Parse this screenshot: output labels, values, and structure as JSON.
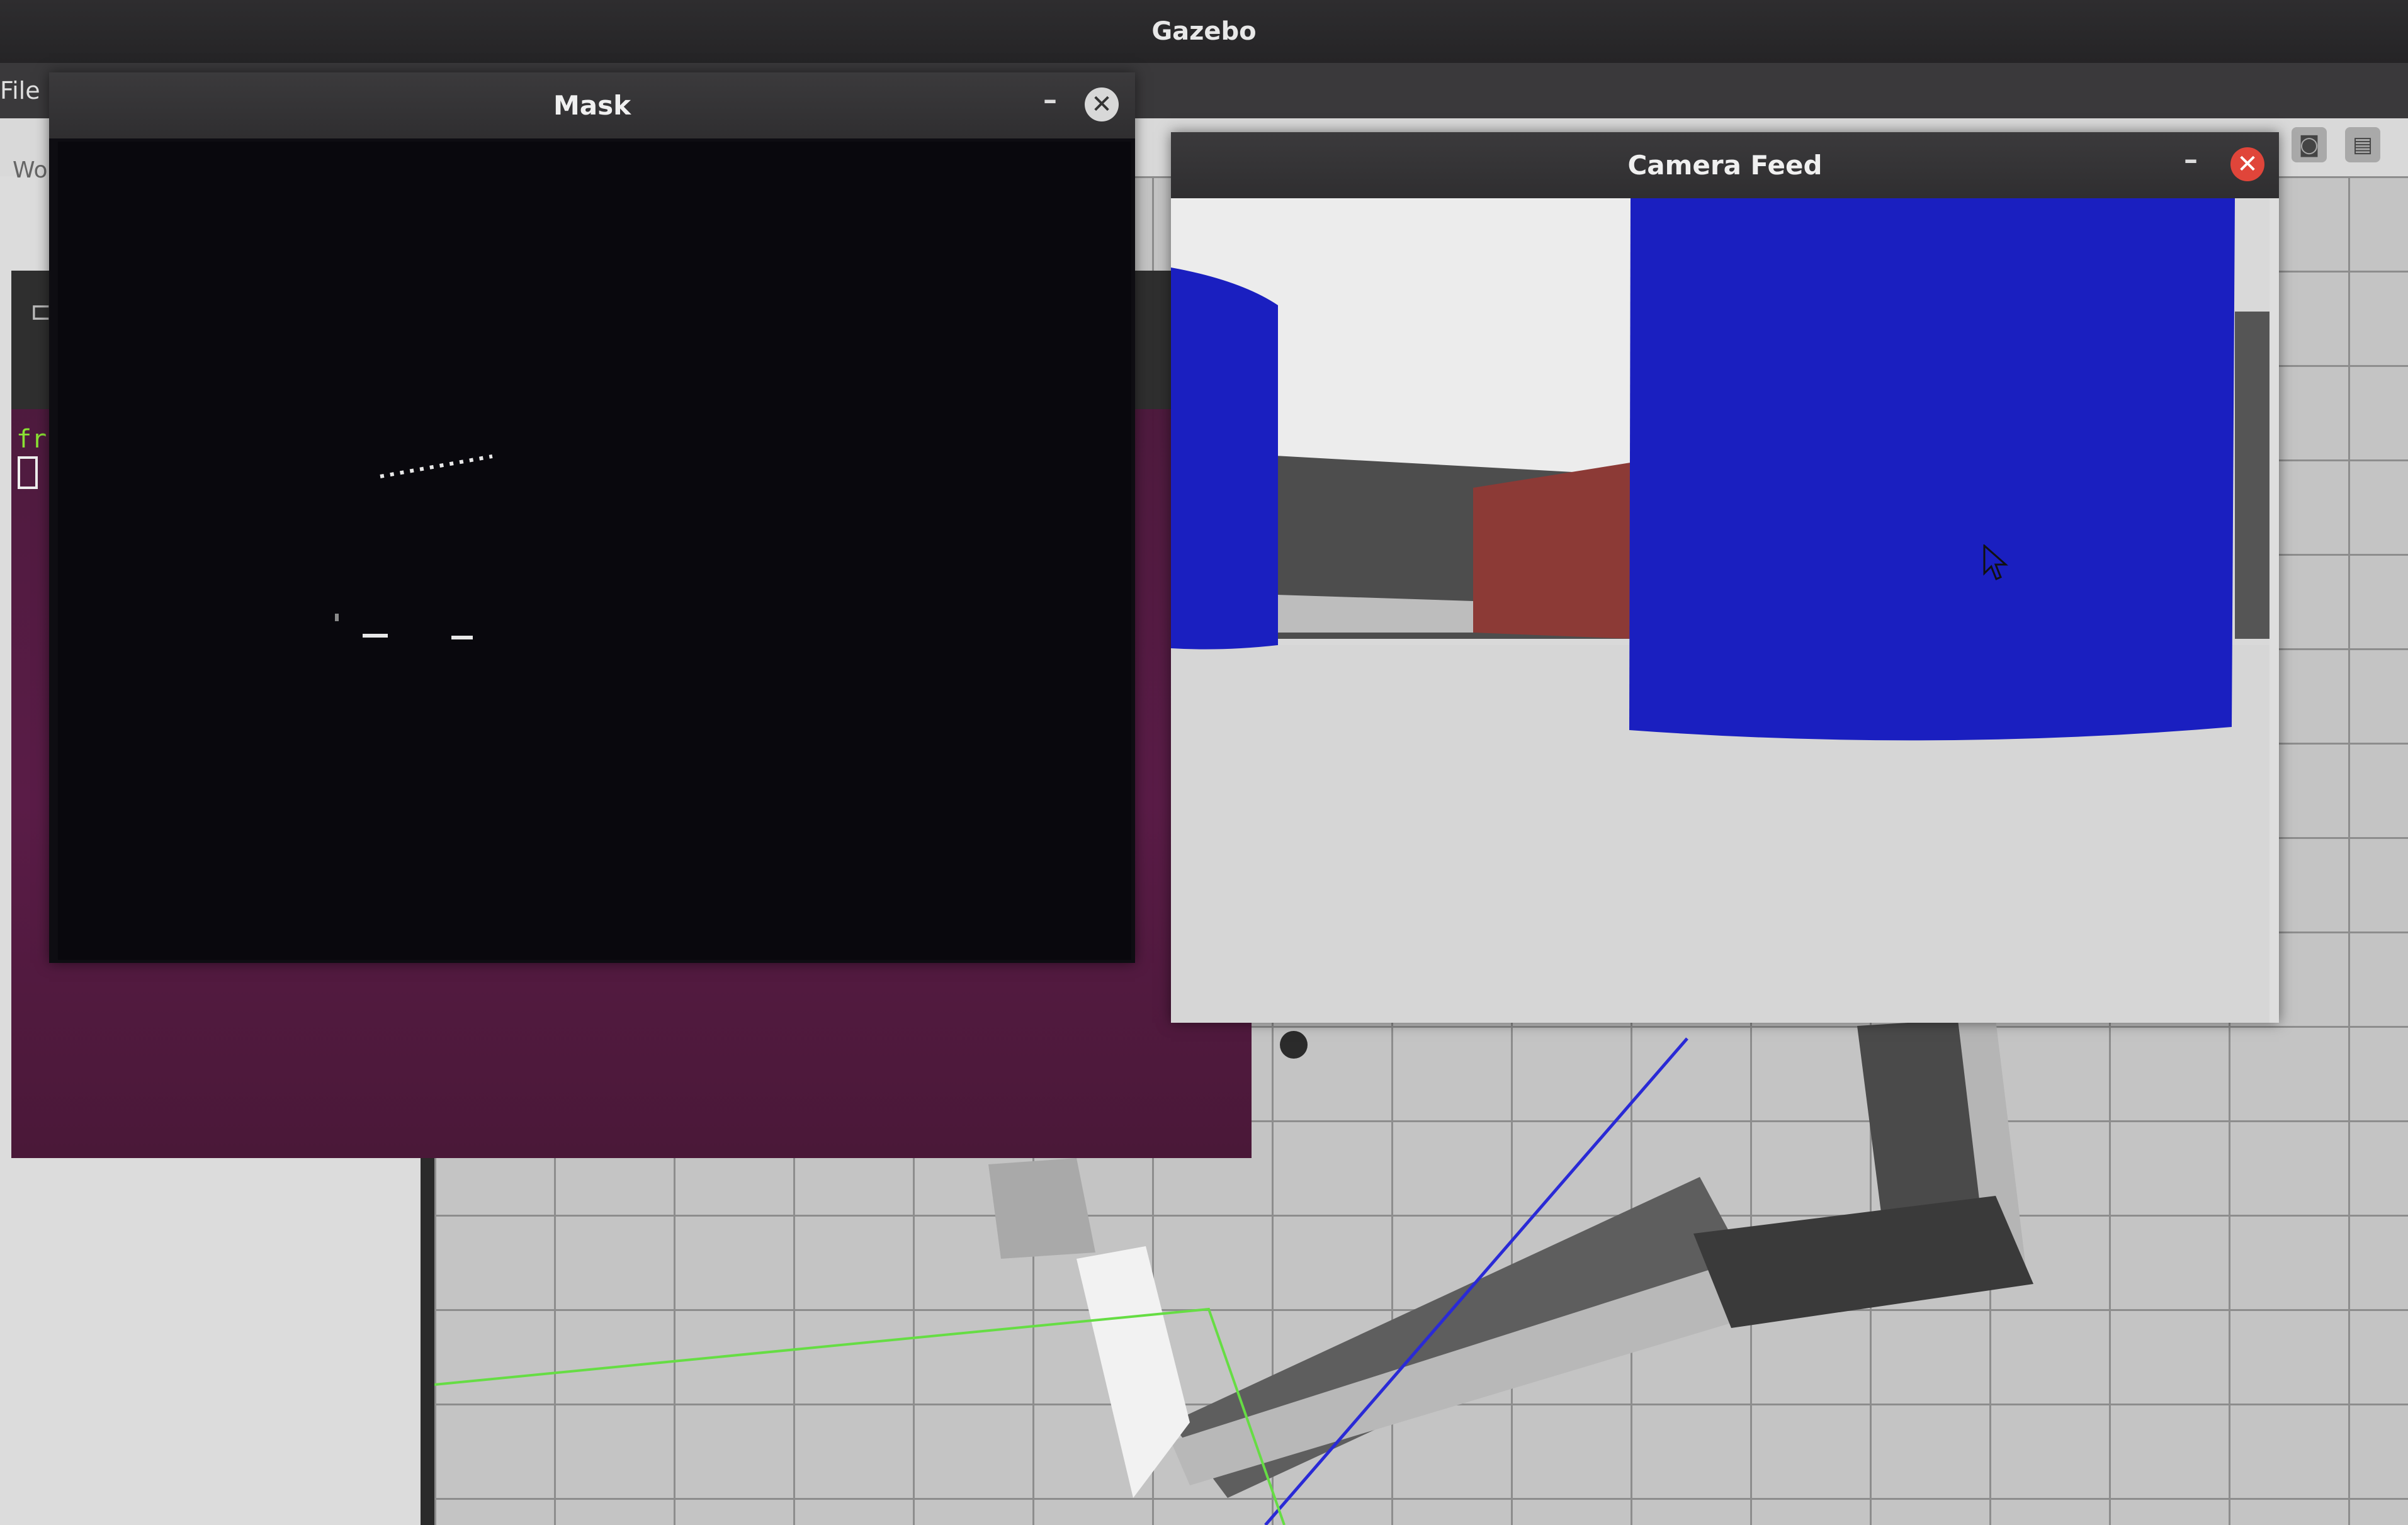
{
  "app": {
    "title": "Gazebo"
  },
  "menubar": {
    "file_label": "File"
  },
  "left_panel": {
    "label": "Wo"
  },
  "terminal": {
    "prompt_fragment": "frc"
  },
  "mask_window": {
    "title": "Mask",
    "minimize_label": "–",
    "close_label": "✕"
  },
  "camera_window": {
    "title": "Camera Feed",
    "minimize_label": "–",
    "close_label": "✕"
  },
  "colors": {
    "close_red": "#e0453a",
    "close_grey": "#d8d8d8",
    "cylinder_blue": "#1a1fc0",
    "block_red": "#8a3a35",
    "terminal_purple": "#5a1c47"
  },
  "icons": {
    "close": "close-icon",
    "minimize": "minimize-icon",
    "camera": "camera-icon",
    "log": "log-icon",
    "cursor": "mouse-cursor-icon"
  }
}
